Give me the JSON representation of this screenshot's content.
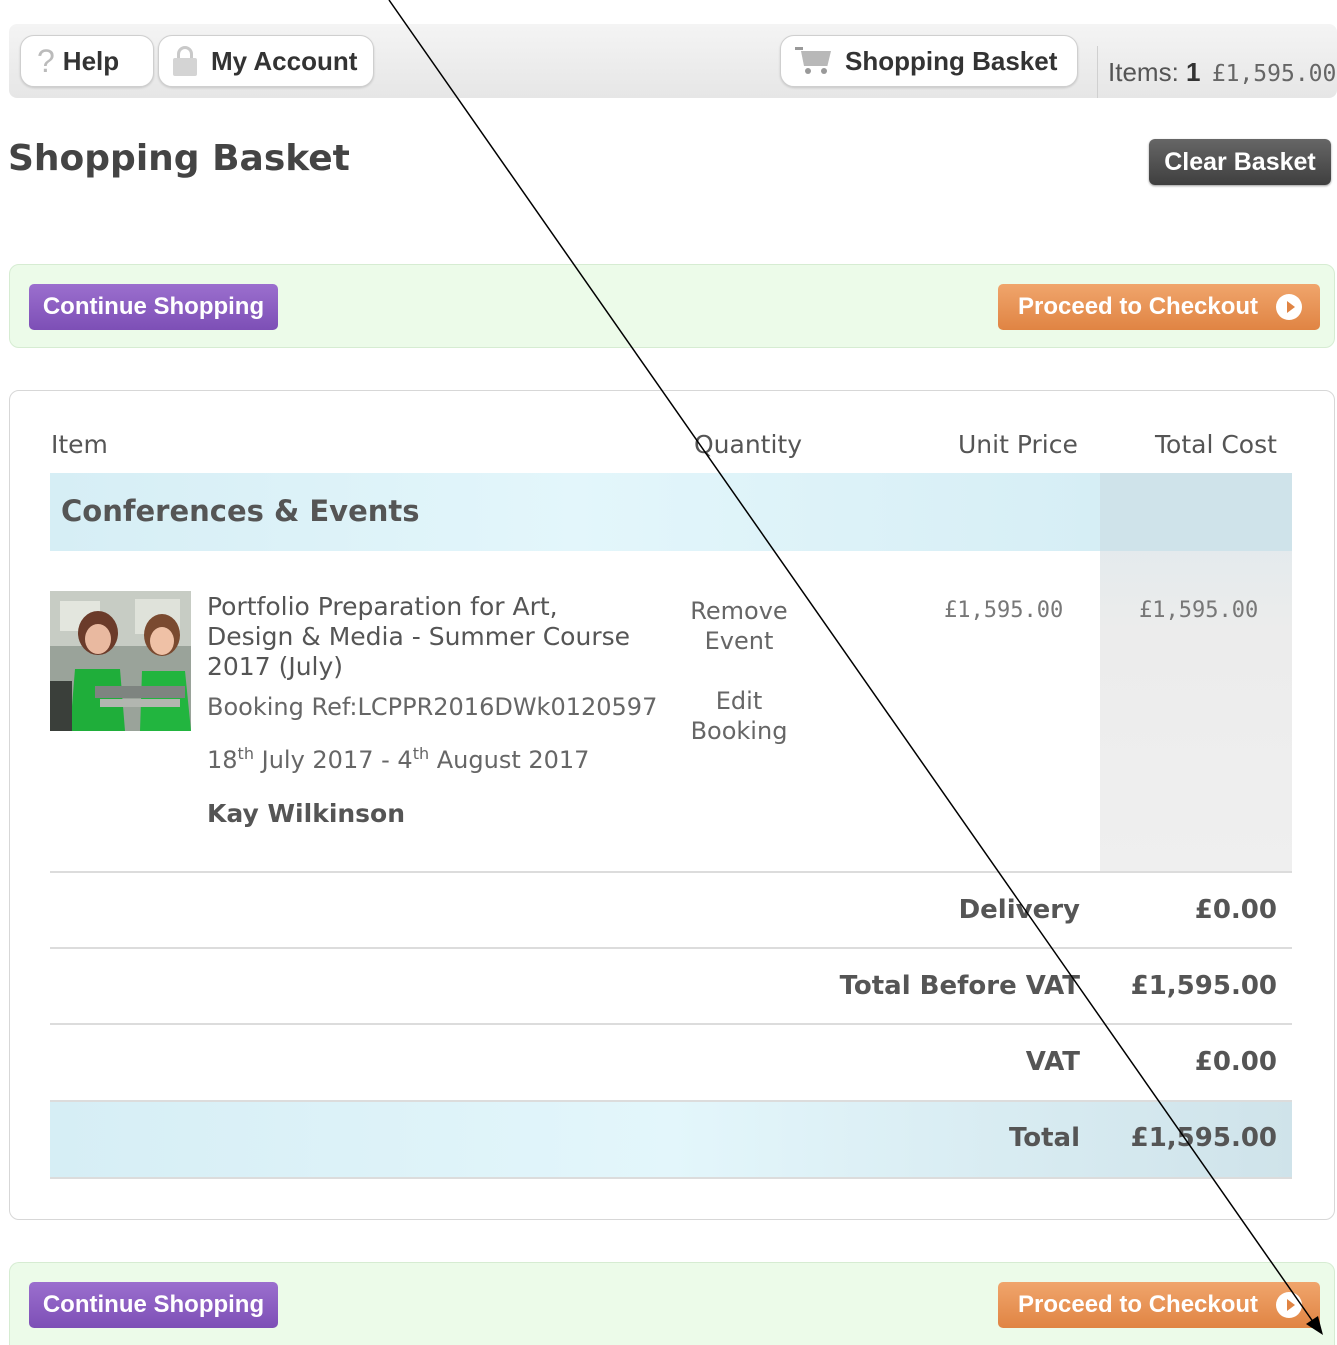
{
  "topbar": {
    "help_label": "Help",
    "account_label": "My Account",
    "basket_label": "Shopping Basket",
    "items_label": "Items:",
    "items_count": "1",
    "items_total": "£1,595.00"
  },
  "page": {
    "title": "Shopping Basket",
    "clear_label": "Clear Basket"
  },
  "actions": {
    "continue_label": "Continue Shopping",
    "checkout_label": "Proceed to Checkout"
  },
  "table": {
    "headers": {
      "item": "Item",
      "quantity": "Quantity",
      "unit_price": "Unit Price",
      "total_cost": "Total Cost"
    },
    "section": "Conferences & Events",
    "item": {
      "title": "Portfolio Preparation for Art, Design & Media - Summer Course 2017 (July)",
      "booking_ref": "Booking Ref:LCPPR2016DWk0120597",
      "date_start_day": "18",
      "date_start_sup": "th",
      "date_start_rest": "July 2017 -",
      "date_end_day": "4",
      "date_end_sup": "th",
      "date_end_rest": "August 2017",
      "attendee": "Kay Wilkinson",
      "remove_label": "Remove Event",
      "edit_label": "Edit Booking",
      "unit_price": "£1,595.00",
      "total_cost": "£1,595.00"
    },
    "summary": {
      "delivery_label": "Delivery",
      "delivery_value": "£0.00",
      "before_vat_label": "Total Before VAT",
      "before_vat_value": "£1,595.00",
      "vat_label": "VAT",
      "vat_value": "£0.00",
      "total_label": "Total",
      "total_value": "£1,595.00"
    }
  }
}
